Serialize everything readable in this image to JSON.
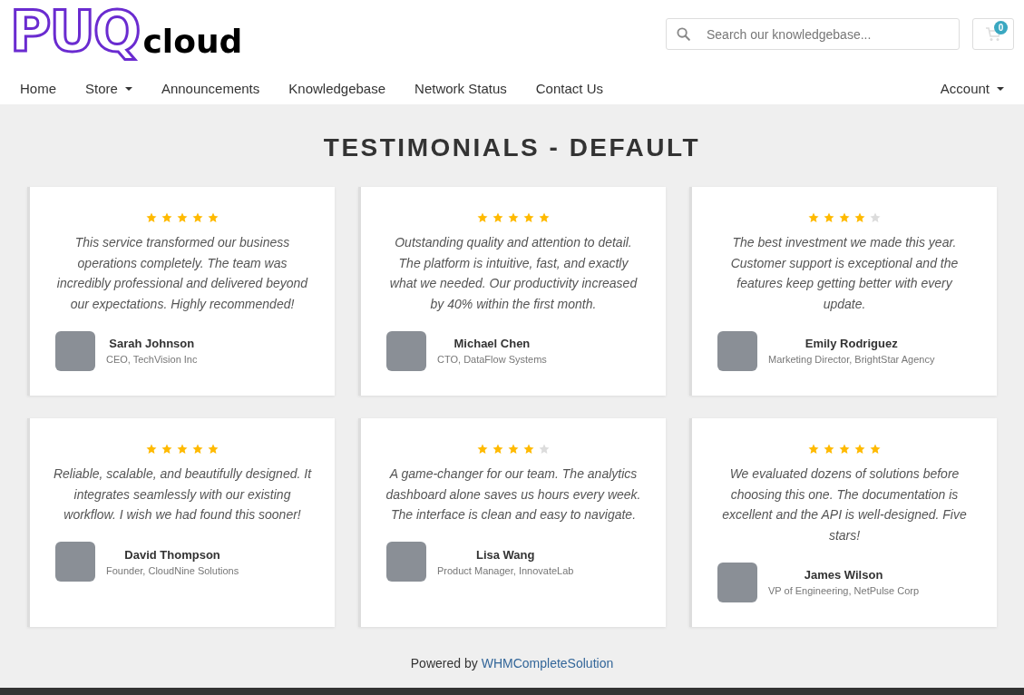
{
  "logo": {
    "mark": "PUQ",
    "text": "cloud"
  },
  "search": {
    "placeholder": "Search our knowledgebase..."
  },
  "cart": {
    "count": "0"
  },
  "nav": [
    {
      "label": "Home",
      "dropdown": false
    },
    {
      "label": "Store",
      "dropdown": true
    },
    {
      "label": "Announcements",
      "dropdown": false
    },
    {
      "label": "Knowledgebase",
      "dropdown": false
    },
    {
      "label": "Network Status",
      "dropdown": false
    },
    {
      "label": "Contact Us",
      "dropdown": false
    }
  ],
  "account": {
    "label": "Account",
    "dropdown": true
  },
  "title": "TESTIMONIALS - DEFAULT",
  "testimonials": [
    {
      "stars": 5,
      "quote": "This service transformed our business operations completely. The team was incredibly professional and delivered beyond our expectations. Highly recommended!",
      "name": "Sarah Johnson",
      "role": "CEO, TechVision Inc"
    },
    {
      "stars": 5,
      "quote": "Outstanding quality and attention to detail. The platform is intuitive, fast, and exactly what we needed. Our productivity increased by 40% within the first month.",
      "name": "Michael Chen",
      "role": "CTO, DataFlow Systems"
    },
    {
      "stars": 4,
      "quote": "The best investment we made this year. Customer support is exceptional and the features keep getting better with every update.",
      "name": "Emily Rodriguez",
      "role": "Marketing Director, BrightStar Agency"
    },
    {
      "stars": 5,
      "quote": "Reliable, scalable, and beautifully designed. It integrates seamlessly with our existing workflow. I wish we had found this sooner!",
      "name": "David Thompson",
      "role": "Founder, CloudNine Solutions"
    },
    {
      "stars": 4,
      "quote": "A game-changer for our team. The analytics dashboard alone saves us hours every week. The interface is clean and easy to navigate.",
      "name": "Lisa Wang",
      "role": "Product Manager, InnovateLab"
    },
    {
      "stars": 5,
      "quote": "We evaluated dozens of solutions before choosing this one. The documentation is excellent and the API is well-designed. Five stars!",
      "name": "James Wilson",
      "role": "VP of Engineering, NetPulse Corp"
    }
  ],
  "footer": {
    "text": "Powered by",
    "link": "WHMCompleteSolution"
  }
}
